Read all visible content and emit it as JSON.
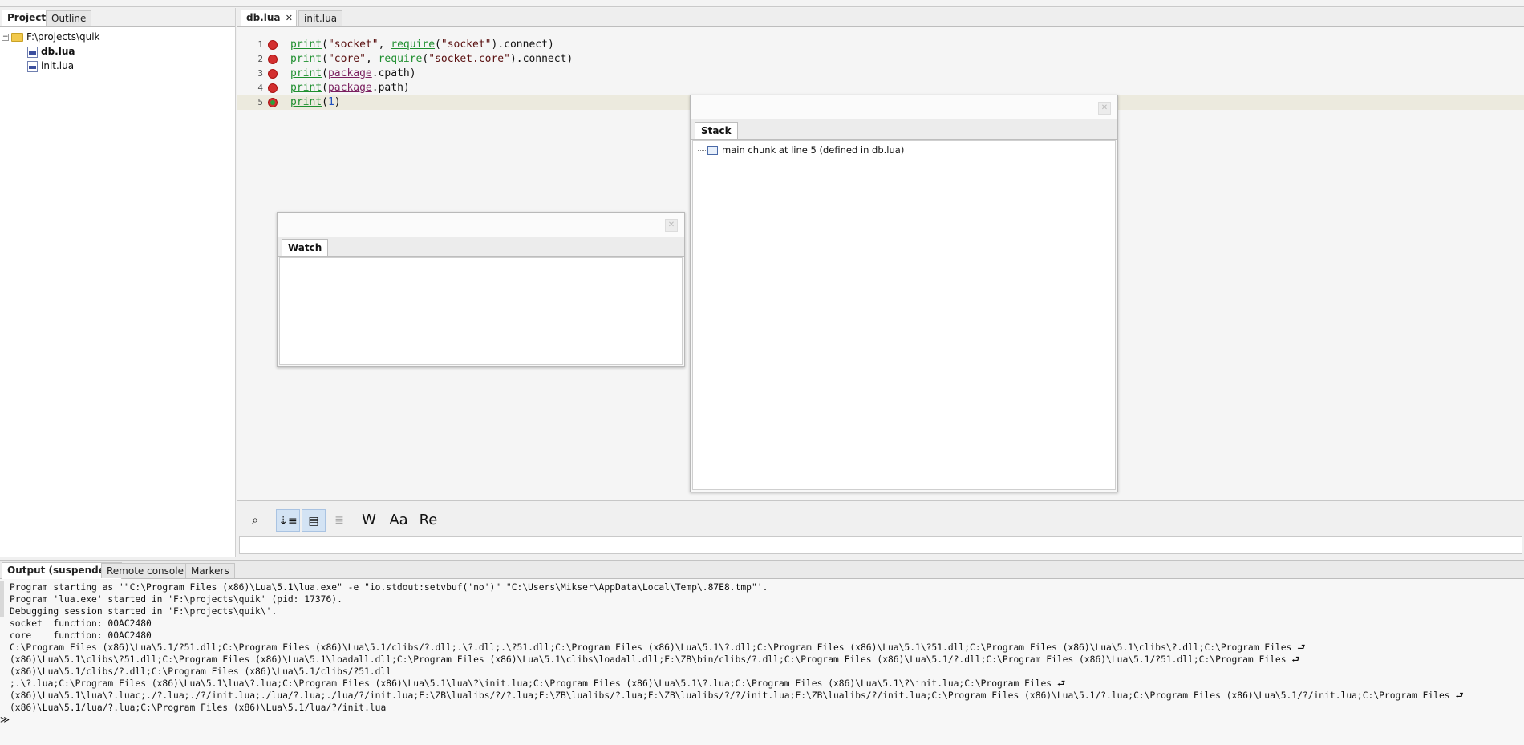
{
  "left_panel": {
    "tabs": [
      "Project",
      "Outline"
    ],
    "tree": {
      "root": "F:\\projects\\quik",
      "files": [
        "db.lua",
        "init.lua"
      ]
    }
  },
  "editor": {
    "tabs": [
      "db.lua",
      "init.lua"
    ],
    "close_glyph": "✕",
    "lines": [
      {
        "num": "1"
      },
      {
        "num": "2"
      },
      {
        "num": "3"
      },
      {
        "num": "4"
      },
      {
        "num": "5"
      }
    ]
  },
  "watch": {
    "tab": "Watch"
  },
  "stack": {
    "tab": "Stack",
    "items": [
      "main chunk at line 5 (defined in db.lua)"
    ]
  },
  "findbar": {
    "buttons": [
      "W",
      "Aa",
      "Re"
    ]
  },
  "output": {
    "tabs": [
      "Output (suspended)",
      "Remote console",
      "Markers"
    ],
    "lines": [
      "Program starting as '\"C:\\Program Files (x86)\\Lua\\5.1\\lua.exe\" -e \"io.stdout:setvbuf('no')\" \"C:\\Users\\Mikser\\AppData\\Local\\Temp\\.87E8.tmp\"'.",
      "Program 'lua.exe' started in 'F:\\projects\\quik' (pid: 17376).",
      "Debugging session started in 'F:\\projects\\quik\\'.",
      "socket  function: 00AC2480",
      "core    function: 00AC2480",
      "C:\\Program Files (x86)\\Lua\\5.1/?51.dll;C:\\Program Files (x86)\\Lua\\5.1/clibs/?.dll;.\\?.dll;.\\?51.dll;C:\\Program Files (x86)\\Lua\\5.1\\?.dll;C:\\Program Files (x86)\\Lua\\5.1\\?51.dll;C:\\Program Files (x86)\\Lua\\5.1\\clibs\\?.dll;C:\\Program Files ⮐",
      "(x86)\\Lua\\5.1\\clibs\\?51.dll;C:\\Program Files (x86)\\Lua\\5.1\\loadall.dll;C:\\Program Files (x86)\\Lua\\5.1\\clibs\\loadall.dll;F:\\ZB\\bin/clibs/?.dll;C:\\Program Files (x86)\\Lua\\5.1/?.dll;C:\\Program Files (x86)\\Lua\\5.1/?51.dll;C:\\Program Files ⮐",
      "(x86)\\Lua\\5.1/clibs/?.dll;C:\\Program Files (x86)\\Lua\\5.1/clibs/?51.dll",
      ";.\\?.lua;C:\\Program Files (x86)\\Lua\\5.1\\lua\\?.lua;C:\\Program Files (x86)\\Lua\\5.1\\lua\\?\\init.lua;C:\\Program Files (x86)\\Lua\\5.1\\?.lua;C:\\Program Files (x86)\\Lua\\5.1\\?\\init.lua;C:\\Program Files ⮐",
      "(x86)\\Lua\\5.1\\lua\\?.luac;./?.lua;./?/init.lua;./lua/?.lua;./lua/?/init.lua;F:\\ZB\\lualibs/?/?.lua;F:\\ZB\\lualibs/?.lua;F:\\ZB\\lualibs/?/?/init.lua;F:\\ZB\\lualibs/?/init.lua;C:\\Program Files (x86)\\Lua\\5.1/?.lua;C:\\Program Files (x86)\\Lua\\5.1/?/init.lua;C:\\Program Files ⮐",
      "(x86)\\Lua\\5.1/lua/?.lua;C:\\Program Files (x86)\\Lua\\5.1/lua/?/init.lua"
    ],
    "prompt": "≫"
  },
  "colors": {
    "breakpoint": "#d32f2f",
    "keyword": "#1f8f2f",
    "current_line": "#eceade",
    "selected_button": "#d3e3f4"
  }
}
